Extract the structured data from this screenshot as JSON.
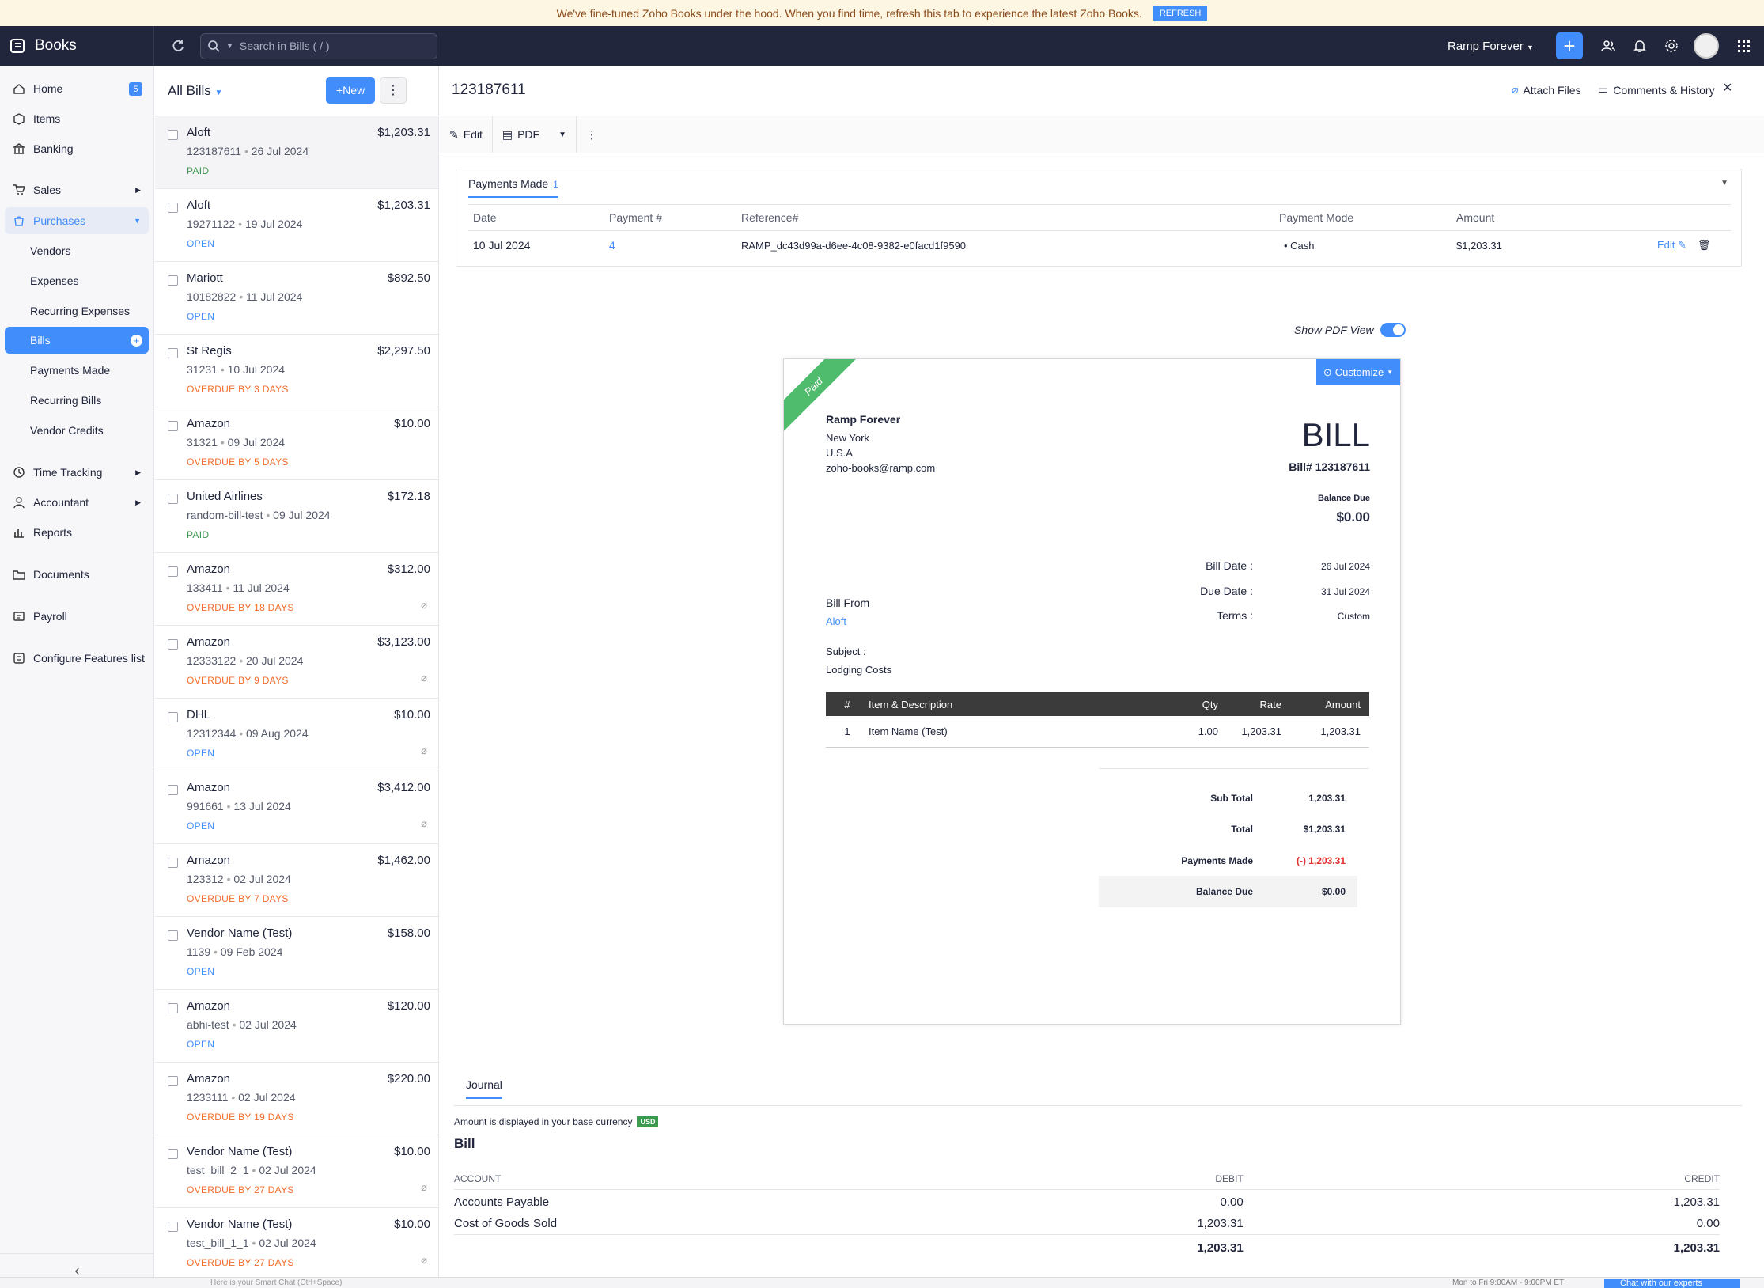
{
  "banner": {
    "text": "We've fine-tuned Zoho Books under the hood. When you find time, refresh this tab to experience the latest Zoho Books.",
    "button": "REFRESH"
  },
  "topbar": {
    "app_name": "Books",
    "search_placeholder": "Search in Bills ( / )",
    "org_name": "Ramp Forever"
  },
  "sidebar": {
    "home": "Home",
    "home_badge": "5",
    "items": "Items",
    "banking": "Banking",
    "sales": "Sales",
    "purchases": "Purchases",
    "vendors": "Vendors",
    "expenses": "Expenses",
    "recurring_expenses": "Recurring Expenses",
    "bills": "Bills",
    "payments_made": "Payments Made",
    "recurring_bills": "Recurring Bills",
    "vendor_credits": "Vendor Credits",
    "time_tracking": "Time Tracking",
    "accountant": "Accountant",
    "reports": "Reports",
    "documents": "Documents",
    "payroll": "Payroll",
    "configure": "Configure Features list"
  },
  "list": {
    "title": "All Bills",
    "new_label": "New",
    "bills": [
      {
        "vendor": "Aloft",
        "amount": "$1,203.31",
        "number": "123187611",
        "date": "26 Jul 2024",
        "status": "PAID",
        "cls": "PAID",
        "clip": ""
      },
      {
        "vendor": "Aloft",
        "amount": "$1,203.31",
        "number": "19271122",
        "date": "19 Jul 2024",
        "status": "OPEN",
        "cls": "OPEN",
        "clip": ""
      },
      {
        "vendor": "Mariott",
        "amount": "$892.50",
        "number": "10182822",
        "date": "11 Jul 2024",
        "status": "OPEN",
        "cls": "OPEN",
        "clip": ""
      },
      {
        "vendor": "St Regis",
        "amount": "$2,297.50",
        "number": "31231",
        "date": "10 Jul 2024",
        "status": "OVERDUE BY 3 DAYS",
        "cls": "OVER",
        "clip": ""
      },
      {
        "vendor": "Amazon",
        "amount": "$10.00",
        "number": "31321",
        "date": "09 Jul 2024",
        "status": "OVERDUE BY 5 DAYS",
        "cls": "OVER",
        "clip": ""
      },
      {
        "vendor": "United Airlines",
        "amount": "$172.18",
        "number": "random-bill-test",
        "date": "09 Jul 2024",
        "status": "PAID",
        "cls": "PAID",
        "clip": ""
      },
      {
        "vendor": "Amazon",
        "amount": "$312.00",
        "number": "133411",
        "date": "11 Jul 2024",
        "status": "OVERDUE BY 18 DAYS",
        "cls": "OVER",
        "clip": "⌀"
      },
      {
        "vendor": "Amazon",
        "amount": "$3,123.00",
        "number": "12333122",
        "date": "20 Jul 2024",
        "status": "OVERDUE BY 9 DAYS",
        "cls": "OVER",
        "clip": "⌀"
      },
      {
        "vendor": "DHL",
        "amount": "$10.00",
        "number": "12312344",
        "date": "09 Aug 2024",
        "status": "OPEN",
        "cls": "OPEN",
        "clip": "⌀"
      },
      {
        "vendor": "Amazon",
        "amount": "$3,412.00",
        "number": "991661",
        "date": "13 Jul 2024",
        "status": "OPEN",
        "cls": "OPEN",
        "clip": "⌀"
      },
      {
        "vendor": "Amazon",
        "amount": "$1,462.00",
        "number": "123312",
        "date": "02 Jul 2024",
        "status": "OVERDUE BY 7 DAYS",
        "cls": "OVER",
        "clip": ""
      },
      {
        "vendor": "Vendor Name (Test)",
        "amount": "$158.00",
        "number": "1139",
        "date": "09 Feb 2024",
        "status": "OPEN",
        "cls": "OPEN",
        "clip": ""
      },
      {
        "vendor": "Amazon",
        "amount": "$120.00",
        "number": "abhi-test",
        "date": "02 Jul 2024",
        "status": "OPEN",
        "cls": "OPEN",
        "clip": ""
      },
      {
        "vendor": "Amazon",
        "amount": "$220.00",
        "number": "1233111",
        "date": "02 Jul 2024",
        "status": "OVERDUE BY 19 DAYS",
        "cls": "OVER",
        "clip": ""
      },
      {
        "vendor": "Vendor Name (Test)",
        "amount": "$10.00",
        "number": "test_bill_2_1",
        "date": "02 Jul 2024",
        "status": "OVERDUE BY 27 DAYS",
        "cls": "OVER",
        "clip": "⌀"
      },
      {
        "vendor": "Vendor Name (Test)",
        "amount": "$10.00",
        "number": "test_bill_1_1",
        "date": "02 Jul 2024",
        "status": "OVERDUE BY 27 DAYS",
        "cls": "OVER",
        "clip": "⌀"
      }
    ]
  },
  "detail": {
    "title": "123187611",
    "attach": "Attach Files",
    "comments": "Comments & History",
    "edit": "Edit",
    "pdf": "PDF",
    "payments": {
      "tab": "Payments Made",
      "count": "1",
      "headers": [
        "Date",
        "Payment #",
        "Reference#",
        "Payment Mode",
        "Amount"
      ],
      "row": {
        "date": "10 Jul 2024",
        "number": "4",
        "reference": "RAMP_dc43d99a-d6ee-4c08-9382-e0facd1f9590",
        "mode": "Cash",
        "amount": "$1,203.31",
        "edit": "Edit"
      }
    },
    "show_pdf": "Show PDF View"
  },
  "bill": {
    "ribbon": "Paid",
    "customize": "Customize",
    "company": "Ramp Forever",
    "city": "New York",
    "country": "U.S.A",
    "email": "zoho-books@ramp.com",
    "heading": "BILL",
    "bill_no": "Bill# 123187611",
    "balance_label": "Balance Due",
    "balance": "$0.00",
    "bill_date_label": "Bill Date :",
    "bill_date": "26 Jul 2024",
    "due_date_label": "Due Date :",
    "due_date": "31 Jul 2024",
    "terms_label": "Terms :",
    "terms": "Custom",
    "from_label": "Bill From",
    "from": "Aloft",
    "subject_label": "Subject :",
    "subject": "Lodging Costs",
    "table_headers": {
      "num": "#",
      "item": "Item & Description",
      "qty": "Qty",
      "rate": "Rate",
      "amount": "Amount"
    },
    "line": {
      "num": "1",
      "item": "Item Name (Test)",
      "qty": "1.00",
      "rate": "1,203.31",
      "amount": "1,203.31"
    },
    "sub_total_label": "Sub Total",
    "sub_total": "1,203.31",
    "total_label": "Total",
    "total": "$1,203.31",
    "paid_label": "Payments Made",
    "paid": "(-) 1,203.31",
    "bal_label": "Balance Due",
    "bal": "$0.00"
  },
  "journal": {
    "tab": "Journal",
    "note": "Amount is displayed in your base currency",
    "currency": "USD",
    "section": "Bill",
    "headers": {
      "account": "ACCOUNT",
      "debit": "DEBIT",
      "credit": "CREDIT"
    },
    "rows": [
      {
        "account": "Accounts Payable",
        "debit": "0.00",
        "credit": "1,203.31"
      },
      {
        "account": "Cost of Goods Sold",
        "debit": "1,203.31",
        "credit": "0.00"
      }
    ],
    "total_debit": "1,203.31",
    "total_credit": "1,203.31"
  },
  "footer": {
    "chat_placeholder": "Here is your Smart Chat (Ctrl+Space)",
    "hours": "Mon to Fri 9:00AM - 9:00PM ET",
    "chat_button": "Chat with our experts"
  },
  "colors": {
    "accent": "#408dfb",
    "topbar": "#21263c",
    "paid": "#3c9a4f",
    "overdue": "#f26c2b"
  }
}
